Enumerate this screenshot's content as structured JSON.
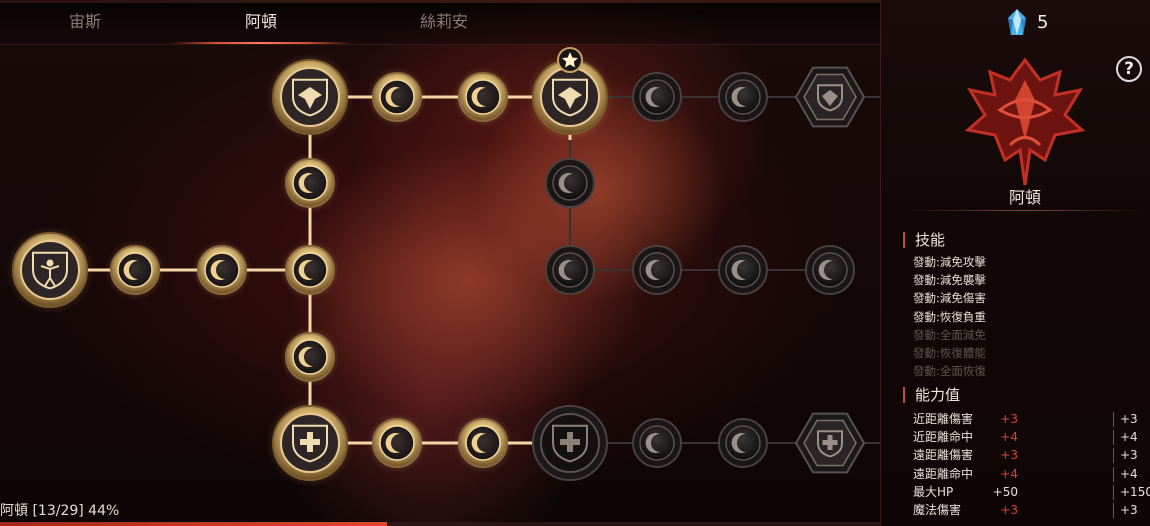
{
  "tabs": [
    "宙斯",
    "阿頓",
    "絲莉安"
  ],
  "active_tab": "阿頓",
  "crystal": {
    "icon": "blue-crystal-icon",
    "count": "5"
  },
  "help_label": "?",
  "character_name": "阿頓",
  "skills_title": "技能",
  "skills": [
    {
      "text": "發動:減免攻擊",
      "active": true
    },
    {
      "text": "發動:減免襲擊",
      "active": true
    },
    {
      "text": "發動:減免傷害",
      "active": true
    },
    {
      "text": "發動:恢復負重",
      "active": true
    },
    {
      "text": "發動:全面減免",
      "active": false
    },
    {
      "text": "發動:恢復體能",
      "active": false
    },
    {
      "text": "發動:全面恢復",
      "active": false
    }
  ],
  "stats_title": "能力值",
  "stats": [
    {
      "name": "近距離傷害",
      "bonus": "+3",
      "total": "+3"
    },
    {
      "name": "近距離命中",
      "bonus": "+4",
      "total": "+4"
    },
    {
      "name": "遠距離傷害",
      "bonus": "+3",
      "total": "+3"
    },
    {
      "name": "遠距離命中",
      "bonus": "+4",
      "total": "+4"
    },
    {
      "name": "最大HP",
      "bonus": "+50",
      "total": "+150"
    },
    {
      "name": "魔法傷害",
      "bonus": "+3",
      "total": "+3"
    }
  ],
  "status_text": "阿頓 [13/29] 44%",
  "progress": 0.44,
  "colors": {
    "accent_red": "#e04030",
    "line_gold": "#f0c890",
    "node_gold": "#c8a060",
    "tab_active": "#f0e6dc"
  }
}
